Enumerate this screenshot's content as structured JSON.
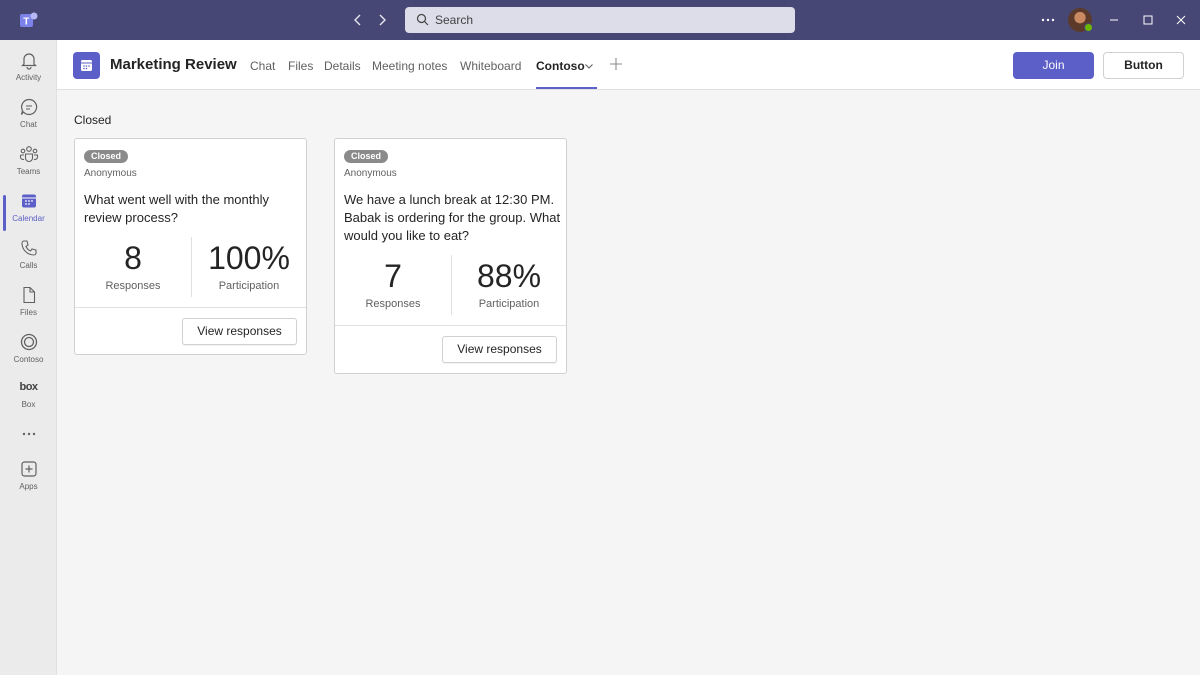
{
  "titlebar": {
    "search_placeholder": "Search",
    "brand_color": "#464775",
    "icons": [
      "teams-logo-icon",
      "back-arrow-icon",
      "forward-arrow-icon",
      "search-icon",
      "more-icon",
      "minimize-icon",
      "maximize-icon",
      "close-icon"
    ]
  },
  "rail": {
    "items": [
      {
        "label": "Activity",
        "icon": "bell-icon"
      },
      {
        "label": "Chat",
        "icon": "chat-icon"
      },
      {
        "label": "Teams",
        "icon": "teams-icon"
      },
      {
        "label": "Calendar",
        "icon": "calendar-icon",
        "active": true
      },
      {
        "label": "Calls",
        "icon": "phone-icon"
      },
      {
        "label": "Files",
        "icon": "file-icon"
      },
      {
        "label": "Contoso",
        "icon": "contoso-icon"
      },
      {
        "label": "Box",
        "icon": "box-icon",
        "logo_text": "box"
      },
      {
        "label": "",
        "icon": "more-apps-icon"
      },
      {
        "label": "Apps",
        "icon": "add-apps-icon"
      }
    ]
  },
  "header": {
    "title": "Marketing Review",
    "tabs": [
      {
        "label": "Chat"
      },
      {
        "label": "Files"
      },
      {
        "label": "Details"
      },
      {
        "label": "Meeting notes"
      },
      {
        "label": "Whiteboard"
      },
      {
        "label": "Contoso",
        "active": true
      }
    ],
    "join_label": "Join",
    "button_label": "Button",
    "accent_color": "#5b5fc7"
  },
  "main": {
    "section_label": "Closed",
    "cards": [
      {
        "badge": "Closed",
        "anonymity": "Anonymous",
        "question": "What went well with the monthly review process?",
        "responses_value": "8",
        "responses_label": "Responses",
        "participation_value": "100%",
        "participation_label": "Participation",
        "action_label": "View responses"
      },
      {
        "badge": "Closed",
        "anonymity": "Anonymous",
        "question": "We have a lunch break at 12:30 PM. Babak is ordering for the group. What would you like to eat?",
        "responses_value": "7",
        "responses_label": "Responses",
        "participation_value": "88%",
        "participation_label": "Participation",
        "action_label": "View responses"
      }
    ]
  }
}
